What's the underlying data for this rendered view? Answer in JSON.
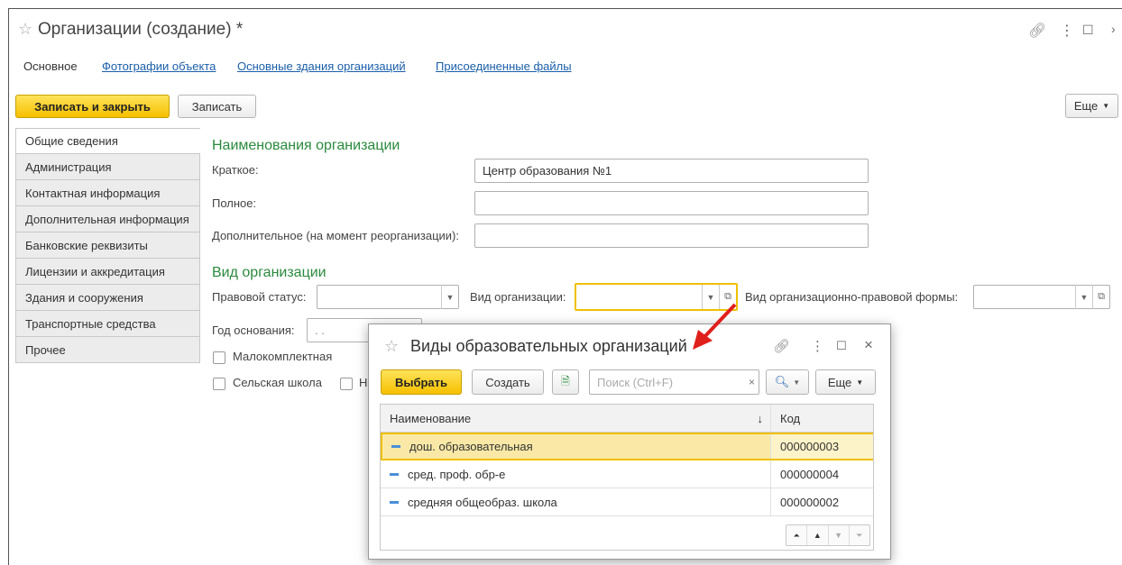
{
  "window": {
    "title": "Организации (создание) *",
    "tabs": [
      "Основное",
      "Фотографии объекта",
      "Основные здания организаций",
      "Присоединенные файлы"
    ]
  },
  "toolbar": {
    "save_close": "Записать и закрыть",
    "save": "Записать",
    "more": "Еще"
  },
  "side_tabs": [
    "Общие сведения",
    "Администрация",
    "Контактная информация",
    "Дополнительная информация",
    "Банковские реквизиты",
    "Лицензии и аккредитация",
    "Здания и сооружения",
    "Транспортные средства",
    "Прочее"
  ],
  "names_section": {
    "heading": "Наименования организации",
    "short_label": "Краткое:",
    "short_value": "Центр образования №1",
    "full_label": "Полное:",
    "full_value": "",
    "extra_label": "Дополнительное (на момент реорганизации):",
    "extra_value": ""
  },
  "kind_section": {
    "heading": "Вид организации",
    "legal_status_label": "Правовой статус:",
    "org_kind_label": "Вид организации:",
    "legal_form_label": "Вид организационно-правовой формы:",
    "year_label": "Год основания:",
    "year_placeholder": " .  .",
    "small_school": "Малокомплектная",
    "rural_school": "Сельская школа",
    "truncated_checkbox": "Н"
  },
  "popup": {
    "title": "Виды образовательных организаций",
    "select": "Выбрать",
    "create": "Создать",
    "search_placeholder": "Поиск (Ctrl+F)",
    "more": "Еще",
    "col_name": "Наименование",
    "col_code": "Код",
    "rows": [
      {
        "name": "дош. образовательная",
        "code": "000000003"
      },
      {
        "name": "сред. проф. обр-е",
        "code": "000000004"
      },
      {
        "name": "средняя общеобраз. школа",
        "code": "000000002"
      }
    ]
  },
  "colors": {
    "accent_yellow": "#f6c000",
    "heading_green": "#2b8a3e",
    "link_blue": "#1b5faa",
    "arrow_red": "#e0201b"
  }
}
